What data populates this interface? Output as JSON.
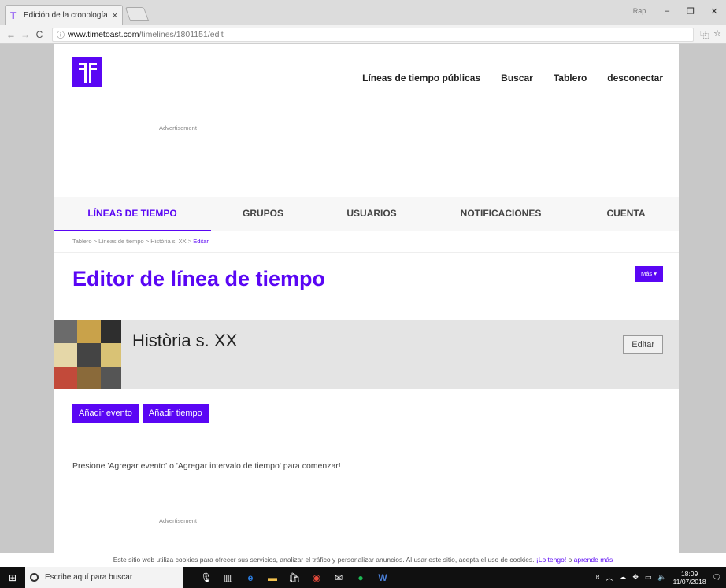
{
  "browser": {
    "tab_title": "Edición de la cronología",
    "tab_close": "×",
    "url_host": "www.timetoast.com",
    "url_path": "/timelines/1801151/edit",
    "window_user": "Rap",
    "minimize": "–",
    "restore": "❐",
    "close": "✕",
    "back": "←",
    "forward": "→",
    "reload": "C",
    "info": "ⓘ",
    "translate": "⿻",
    "bookmark": "☆"
  },
  "header": {
    "nav": [
      "Líneas de tiempo públicas",
      "Buscar",
      "Tablero",
      "desconectar"
    ]
  },
  "ads": {
    "label": "Advertisement"
  },
  "tabs": [
    "LÍNEAS DE TIEMPO",
    "GRUPOS",
    "USUARIOS",
    "NOTIFICACIONES",
    "CUENTA"
  ],
  "breadcrumb": {
    "path": "Tablero > Líneas de tiempo > Història s. XX > ",
    "current": "Editar"
  },
  "page": {
    "title": "Editor de línea de tiempo",
    "more_button": "Más ▾"
  },
  "timeline": {
    "title": "Història s. XX",
    "edit_button": "Editar"
  },
  "actions": {
    "add_event": "Añadir evento",
    "add_span": "Añadir tiempo"
  },
  "hint": "Presione 'Agregar evento' o 'Agregar intervalo de tiempo' para comenzar!",
  "cookie": {
    "text": "Este sitio web utiliza cookies para ofrecer sus servicios, analizar el tráfico y personalizar anuncios. Al usar este sitio, acepta el uso de cookies. ",
    "accept": "¡Lo tengo!",
    "or": " o ",
    "learn": "aprende más"
  },
  "taskbar": {
    "start": "⊞",
    "search_placeholder": "Escribe aquí para buscar",
    "time": "18:09",
    "date": "11/07/2018"
  },
  "colors": {
    "brand": "#5a06f4"
  }
}
